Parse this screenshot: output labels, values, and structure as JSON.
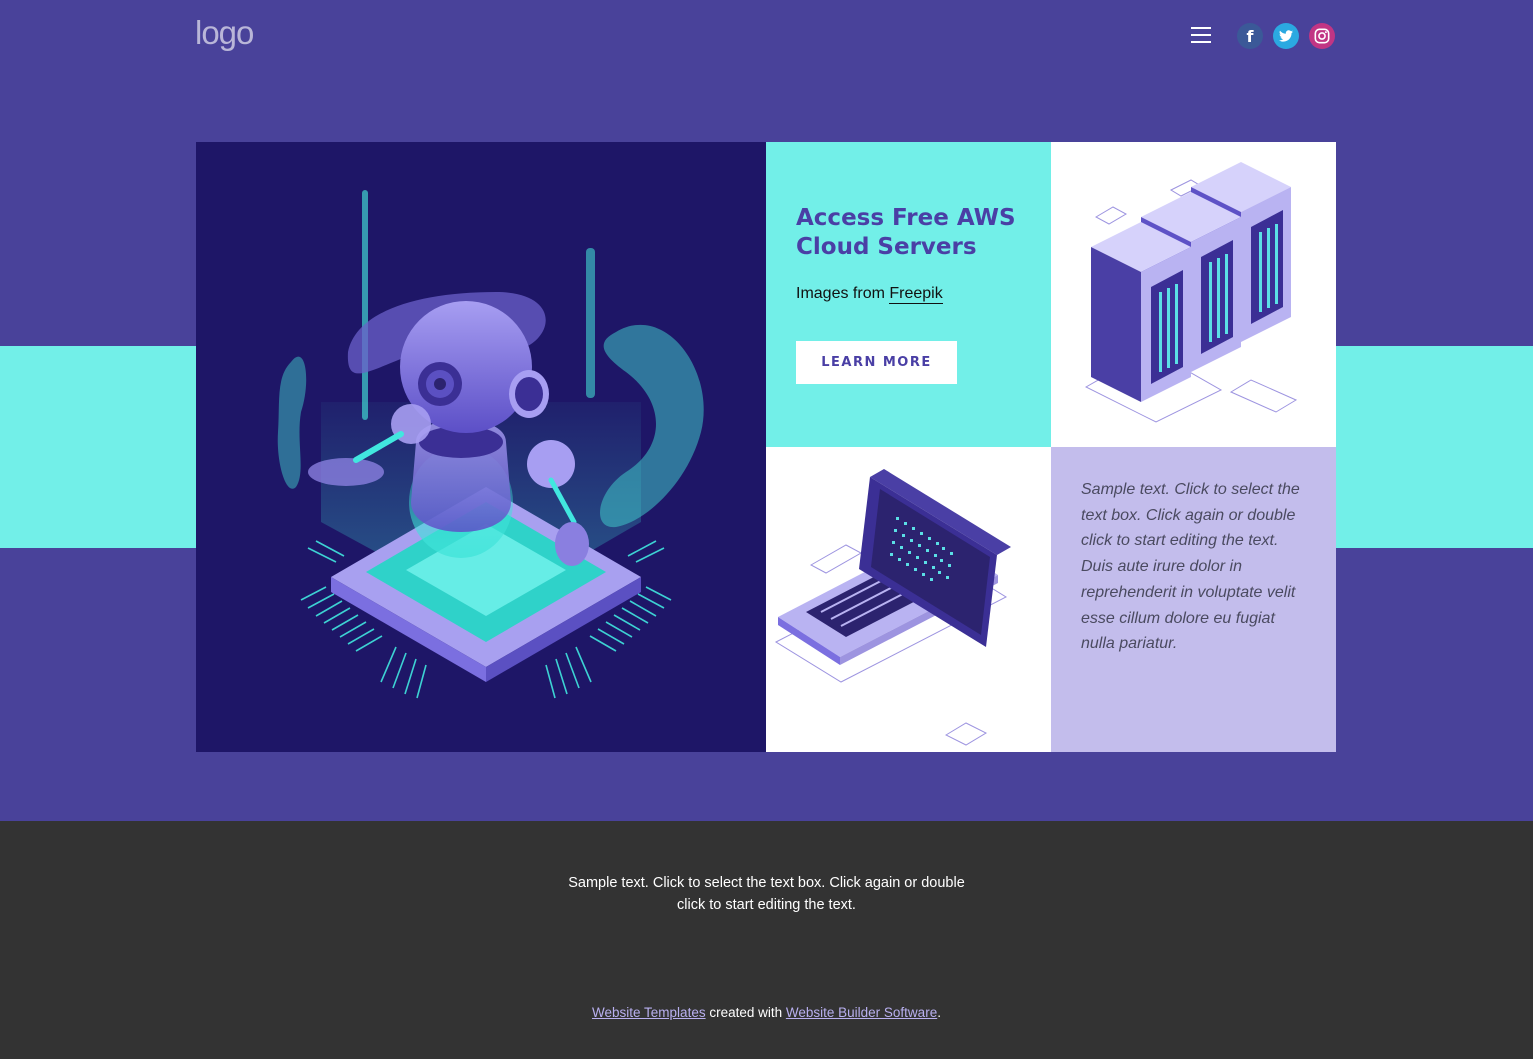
{
  "header": {
    "logo": "logo",
    "menu_icon": "hamburger-menu-icon",
    "social": [
      {
        "name": "facebook-icon",
        "glyph": "f",
        "color": "#3b5998"
      },
      {
        "name": "twitter-icon",
        "glyph": "t",
        "color": "#2ba9e1"
      },
      {
        "name": "instagram-icon",
        "glyph": "◎",
        "color": "#c13584"
      }
    ]
  },
  "hero": {
    "title": "Access Free AWS Cloud Servers",
    "images_prefix": "Images from ",
    "images_link": "Freepik",
    "button_label": "LEARN MORE",
    "sample_text": "Sample text. Click to select the text box. Click again or double click to start editing the text. Duis aute irure dolor in reprehenderit in voluptate velit esse cillum dolore eu fugiat nulla pariatur."
  },
  "footer": {
    "text": "Sample text. Click to select the text box. Click again or double click to start editing the text.",
    "credit_link1": "Website Templates",
    "credit_middle": " created with ",
    "credit_link2": "Website Builder Software",
    "credit_end": "."
  },
  "colors": {
    "background": "#49429a",
    "accent_cyan": "#72efe8",
    "navy": "#1e1667",
    "lavender": "#c3bdec",
    "footer": "#333333"
  }
}
